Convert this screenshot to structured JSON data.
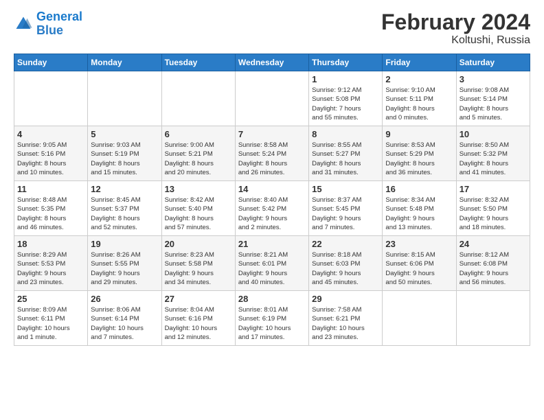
{
  "logo": {
    "line1": "General",
    "line2": "Blue"
  },
  "title": "February 2024",
  "location": "Koltushi, Russia",
  "days_of_week": [
    "Sunday",
    "Monday",
    "Tuesday",
    "Wednesday",
    "Thursday",
    "Friday",
    "Saturday"
  ],
  "weeks": [
    [
      {
        "day": "",
        "info": ""
      },
      {
        "day": "",
        "info": ""
      },
      {
        "day": "",
        "info": ""
      },
      {
        "day": "",
        "info": ""
      },
      {
        "day": "1",
        "info": "Sunrise: 9:12 AM\nSunset: 5:08 PM\nDaylight: 7 hours\nand 55 minutes."
      },
      {
        "day": "2",
        "info": "Sunrise: 9:10 AM\nSunset: 5:11 PM\nDaylight: 8 hours\nand 0 minutes."
      },
      {
        "day": "3",
        "info": "Sunrise: 9:08 AM\nSunset: 5:14 PM\nDaylight: 8 hours\nand 5 minutes."
      }
    ],
    [
      {
        "day": "4",
        "info": "Sunrise: 9:05 AM\nSunset: 5:16 PM\nDaylight: 8 hours\nand 10 minutes."
      },
      {
        "day": "5",
        "info": "Sunrise: 9:03 AM\nSunset: 5:19 PM\nDaylight: 8 hours\nand 15 minutes."
      },
      {
        "day": "6",
        "info": "Sunrise: 9:00 AM\nSunset: 5:21 PM\nDaylight: 8 hours\nand 20 minutes."
      },
      {
        "day": "7",
        "info": "Sunrise: 8:58 AM\nSunset: 5:24 PM\nDaylight: 8 hours\nand 26 minutes."
      },
      {
        "day": "8",
        "info": "Sunrise: 8:55 AM\nSunset: 5:27 PM\nDaylight: 8 hours\nand 31 minutes."
      },
      {
        "day": "9",
        "info": "Sunrise: 8:53 AM\nSunset: 5:29 PM\nDaylight: 8 hours\nand 36 minutes."
      },
      {
        "day": "10",
        "info": "Sunrise: 8:50 AM\nSunset: 5:32 PM\nDaylight: 8 hours\nand 41 minutes."
      }
    ],
    [
      {
        "day": "11",
        "info": "Sunrise: 8:48 AM\nSunset: 5:35 PM\nDaylight: 8 hours\nand 46 minutes."
      },
      {
        "day": "12",
        "info": "Sunrise: 8:45 AM\nSunset: 5:37 PM\nDaylight: 8 hours\nand 52 minutes."
      },
      {
        "day": "13",
        "info": "Sunrise: 8:42 AM\nSunset: 5:40 PM\nDaylight: 8 hours\nand 57 minutes."
      },
      {
        "day": "14",
        "info": "Sunrise: 8:40 AM\nSunset: 5:42 PM\nDaylight: 9 hours\nand 2 minutes."
      },
      {
        "day": "15",
        "info": "Sunrise: 8:37 AM\nSunset: 5:45 PM\nDaylight: 9 hours\nand 7 minutes."
      },
      {
        "day": "16",
        "info": "Sunrise: 8:34 AM\nSunset: 5:48 PM\nDaylight: 9 hours\nand 13 minutes."
      },
      {
        "day": "17",
        "info": "Sunrise: 8:32 AM\nSunset: 5:50 PM\nDaylight: 9 hours\nand 18 minutes."
      }
    ],
    [
      {
        "day": "18",
        "info": "Sunrise: 8:29 AM\nSunset: 5:53 PM\nDaylight: 9 hours\nand 23 minutes."
      },
      {
        "day": "19",
        "info": "Sunrise: 8:26 AM\nSunset: 5:55 PM\nDaylight: 9 hours\nand 29 minutes."
      },
      {
        "day": "20",
        "info": "Sunrise: 8:23 AM\nSunset: 5:58 PM\nDaylight: 9 hours\nand 34 minutes."
      },
      {
        "day": "21",
        "info": "Sunrise: 8:21 AM\nSunset: 6:01 PM\nDaylight: 9 hours\nand 40 minutes."
      },
      {
        "day": "22",
        "info": "Sunrise: 8:18 AM\nSunset: 6:03 PM\nDaylight: 9 hours\nand 45 minutes."
      },
      {
        "day": "23",
        "info": "Sunrise: 8:15 AM\nSunset: 6:06 PM\nDaylight: 9 hours\nand 50 minutes."
      },
      {
        "day": "24",
        "info": "Sunrise: 8:12 AM\nSunset: 6:08 PM\nDaylight: 9 hours\nand 56 minutes."
      }
    ],
    [
      {
        "day": "25",
        "info": "Sunrise: 8:09 AM\nSunset: 6:11 PM\nDaylight: 10 hours\nand 1 minute."
      },
      {
        "day": "26",
        "info": "Sunrise: 8:06 AM\nSunset: 6:14 PM\nDaylight: 10 hours\nand 7 minutes."
      },
      {
        "day": "27",
        "info": "Sunrise: 8:04 AM\nSunset: 6:16 PM\nDaylight: 10 hours\nand 12 minutes."
      },
      {
        "day": "28",
        "info": "Sunrise: 8:01 AM\nSunset: 6:19 PM\nDaylight: 10 hours\nand 17 minutes."
      },
      {
        "day": "29",
        "info": "Sunrise: 7:58 AM\nSunset: 6:21 PM\nDaylight: 10 hours\nand 23 minutes."
      },
      {
        "day": "",
        "info": ""
      },
      {
        "day": "",
        "info": ""
      }
    ]
  ]
}
